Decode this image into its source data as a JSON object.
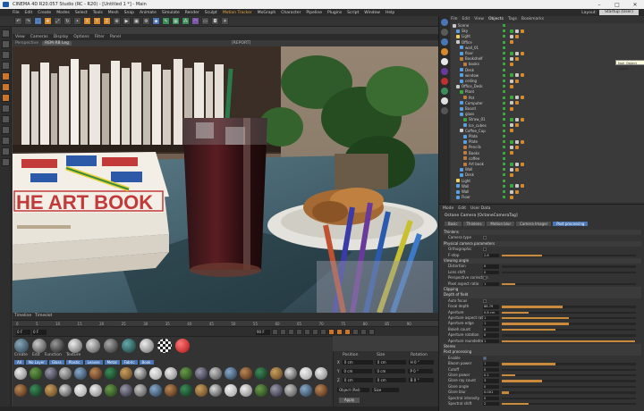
{
  "titlebar": {
    "title": "CINEMA 4D R20.057 Studio (RC - R20) - [Untitled 1 *] - Main"
  },
  "menubar": {
    "items": [
      "File",
      "Edit",
      "Create",
      "Modes",
      "Select",
      "Tools",
      "Mesh",
      "Snap",
      "Animate",
      "Simulate",
      "Render",
      "Sculpt",
      "Motion Tracker",
      "MoGraph",
      "Character",
      "Pipeline",
      "Plugins",
      "Script",
      "Window",
      "Help"
    ],
    "layout_label": "Layout:",
    "layout_value": "Startup (User)"
  },
  "toolbar": {
    "icons": [
      "undo-icon",
      "redo-icon",
      "live-select-icon",
      "move-icon",
      "scale-icon",
      "rotate-icon",
      "last-tool-icon",
      "x-axis-icon",
      "y-axis-icon",
      "z-axis-icon",
      "coordinate-system-icon",
      "render-view-icon",
      "render-picture-viewer-icon",
      "edit-render-settings-icon",
      "cube-icon",
      "pen-icon",
      "subdivision-icon",
      "array-icon",
      "deformer-icon",
      "floor-icon",
      "camera-icon",
      "light-icon"
    ]
  },
  "viewport": {
    "menu": [
      "View",
      "Cameras",
      "Display",
      "Options",
      "Filter",
      "Panel"
    ],
    "camera_label": "Perspective",
    "hud_chip": "REM RB Leg",
    "hud_center": "[REPORT]"
  },
  "book_title": "HE ART BOOK",
  "timeline": {
    "tabs": [
      "Timeline",
      "Timeslot"
    ],
    "ticks": [
      "0",
      "5",
      "10",
      "15",
      "20",
      "25",
      "30",
      "35",
      "40",
      "45",
      "50",
      "55",
      "60",
      "65",
      "70",
      "75",
      "80",
      "85",
      "90"
    ],
    "start_frame": "0 F",
    "end_frame": "90 F",
    "current_frame": "0 F"
  },
  "materials": {
    "menu": [
      "Create",
      "Edit",
      "Function",
      "Texture"
    ],
    "filters": [
      "All",
      "No Layer",
      "Glass",
      "Plastic",
      "Leaves",
      "Metal",
      "Fabric",
      "Book"
    ]
  },
  "coords": {
    "headers": [
      "Position",
      "Size",
      "Rotation"
    ],
    "rows": [
      {
        "axis": "X",
        "pos": "0 cm",
        "size": "0 cm",
        "rot": "H 0 °"
      },
      {
        "axis": "Y",
        "pos": "0 cm",
        "size": "0 cm",
        "rot": "P 0 °"
      },
      {
        "axis": "Z",
        "pos": "0 cm",
        "size": "0 cm",
        "rot": "B 0 °"
      }
    ],
    "mode": "Object (Rel)",
    "size_mode": "Size",
    "apply": "Apply"
  },
  "objects": {
    "menu": [
      "File",
      "Edit",
      "View",
      "Objects",
      "Tags",
      "Bookmarks"
    ],
    "active_tab": "Objects",
    "rows": [
      {
        "name": "Scene",
        "color": "#c9c9c9",
        "indent": 0
      },
      {
        "name": "Sky",
        "color": "#5aa0e0",
        "indent": 1
      },
      {
        "name": "Light",
        "color": "#f0d060",
        "indent": 1
      },
      {
        "name": "Office",
        "color": "#c9c9c9",
        "indent": 1
      },
      {
        "name": "wall_01",
        "color": "#5aa0e0",
        "indent": 2
      },
      {
        "name": "floor",
        "color": "#5aa0e0",
        "indent": 2
      },
      {
        "name": "Bookshelf",
        "color": "#c07c3c",
        "indent": 2
      },
      {
        "name": "books",
        "color": "#c07c3c",
        "indent": 3
      },
      {
        "name": "Desk",
        "color": "#5aa0e0",
        "indent": 2
      },
      {
        "name": "window",
        "color": "#5aa0e0",
        "indent": 2
      },
      {
        "name": "ceiling",
        "color": "#5aa0e0",
        "indent": 2
      },
      {
        "name": "Office_Desk",
        "color": "#c9c9c9",
        "indent": 1
      },
      {
        "name": "Plant",
        "color": "#3ca83c",
        "indent": 2
      },
      {
        "name": "Pot",
        "color": "#c07c3c",
        "indent": 3
      },
      {
        "name": "Computer",
        "color": "#5aa0e0",
        "indent": 2
      },
      {
        "name": "Board",
        "color": "#5aa0e0",
        "indent": 2
      },
      {
        "name": "glass",
        "color": "#5aa0e0",
        "indent": 2
      },
      {
        "name": "Straw_01",
        "color": "#3ca83c",
        "indent": 3
      },
      {
        "name": "Ice_cubes",
        "color": "#5aa0e0",
        "indent": 3
      },
      {
        "name": "Coffee_Cup",
        "color": "#c9c9c9",
        "indent": 2
      },
      {
        "name": "Plate",
        "color": "#5aa0e0",
        "indent": 3
      },
      {
        "name": "Plate",
        "color": "#5aa0e0",
        "indent": 3
      },
      {
        "name": "Pencils",
        "color": "#c07c3c",
        "indent": 3
      },
      {
        "name": "Books",
        "color": "#c07c3c",
        "indent": 3
      },
      {
        "name": "coffee",
        "color": "#c07c3c",
        "indent": 3
      },
      {
        "name": "Art book",
        "color": "#c07c3c",
        "indent": 3
      },
      {
        "name": "Wall",
        "color": "#5aa0e0",
        "indent": 2
      },
      {
        "name": "Desk",
        "color": "#5aa0e0",
        "indent": 2
      },
      {
        "name": "Light",
        "color": "#f0d060",
        "indent": 1
      },
      {
        "name": "Wall",
        "color": "#5aa0e0",
        "indent": 1
      },
      {
        "name": "Wall",
        "color": "#5aa0e0",
        "indent": 1
      },
      {
        "name": "Floor",
        "color": "#5aa0e0",
        "indent": 1
      }
    ],
    "tooltip": "Null Object (light)"
  },
  "attributes": {
    "menu": [
      "Mode",
      "Edit",
      "User Data"
    ],
    "title": "Octane Camera [OctaneCameraTag]",
    "tabs": [
      "Basic",
      "Thinlens",
      "Motion blur",
      "Camera Imager",
      "Post processing"
    ],
    "active_tab": "Post processing",
    "rows": [
      {
        "type": "sec",
        "label": "Thinlens"
      },
      {
        "type": "cb",
        "label": "Camera type",
        "on": false
      },
      {
        "type": "sec",
        "label": "Physical camera parameters"
      },
      {
        "type": "cb",
        "label": "Orthographic",
        "on": false
      },
      {
        "type": "val",
        "label": "F-stop",
        "value": "2.8",
        "fill": 0.3
      },
      {
        "type": "sec",
        "label": "Viewing angle"
      },
      {
        "type": "val",
        "label": "Distortion",
        "value": "0",
        "fill": 0
      },
      {
        "type": "val",
        "label": "Lens shift",
        "value": "0",
        "fill": 0
      },
      {
        "type": "cb",
        "label": "Perspective correction",
        "on": false
      },
      {
        "type": "val",
        "label": "Pixel aspect ratio",
        "value": "1",
        "fill": 0.1
      },
      {
        "type": "sec",
        "label": "Clipping"
      },
      {
        "type": "sec",
        "label": "Depth of field"
      },
      {
        "type": "cb",
        "label": "Auto focus",
        "on": false
      },
      {
        "type": "val",
        "label": "Focal depth",
        "value": "88.79",
        "fill": 0.45
      },
      {
        "type": "val",
        "label": "Aperture",
        "value": "0.8 cm",
        "fill": 0.2
      },
      {
        "type": "val",
        "label": "Aperture aspect ratio",
        "value": "1",
        "fill": 0.5
      },
      {
        "type": "val",
        "label": "Aperture edge",
        "value": "1",
        "fill": 0.5
      },
      {
        "type": "val",
        "label": "Bokeh count",
        "value": "6",
        "fill": 0.4
      },
      {
        "type": "val",
        "label": "Aperture rotation",
        "value": "0",
        "fill": 0
      },
      {
        "type": "val",
        "label": "Aperture roundedness",
        "value": "1",
        "fill": 0.99
      },
      {
        "type": "sec",
        "label": "Stereo"
      },
      {
        "type": "sec",
        "label": "Post processing"
      },
      {
        "type": "cb",
        "label": "Enable",
        "on": true
      },
      {
        "type": "val",
        "label": "Bloom power",
        "value": "1",
        "fill": 0.4
      },
      {
        "type": "val",
        "label": "Cutoff",
        "value": "0",
        "fill": 0
      },
      {
        "type": "val",
        "label": "Glare power",
        "value": "0.1",
        "fill": 0.1
      },
      {
        "type": "val",
        "label": "Glare ray count",
        "value": "3",
        "fill": 0.3
      },
      {
        "type": "val",
        "label": "Glare angle",
        "value": "0",
        "fill": 0
      },
      {
        "type": "val",
        "label": "Glare blur",
        "value": "0.001",
        "fill": 0.05
      },
      {
        "type": "val",
        "label": "Spectral intensity",
        "value": "0",
        "fill": 0
      },
      {
        "type": "val",
        "label": "Spectral shift",
        "value": "2",
        "fill": 0.2
      }
    ]
  },
  "status": {
    "text": ""
  }
}
